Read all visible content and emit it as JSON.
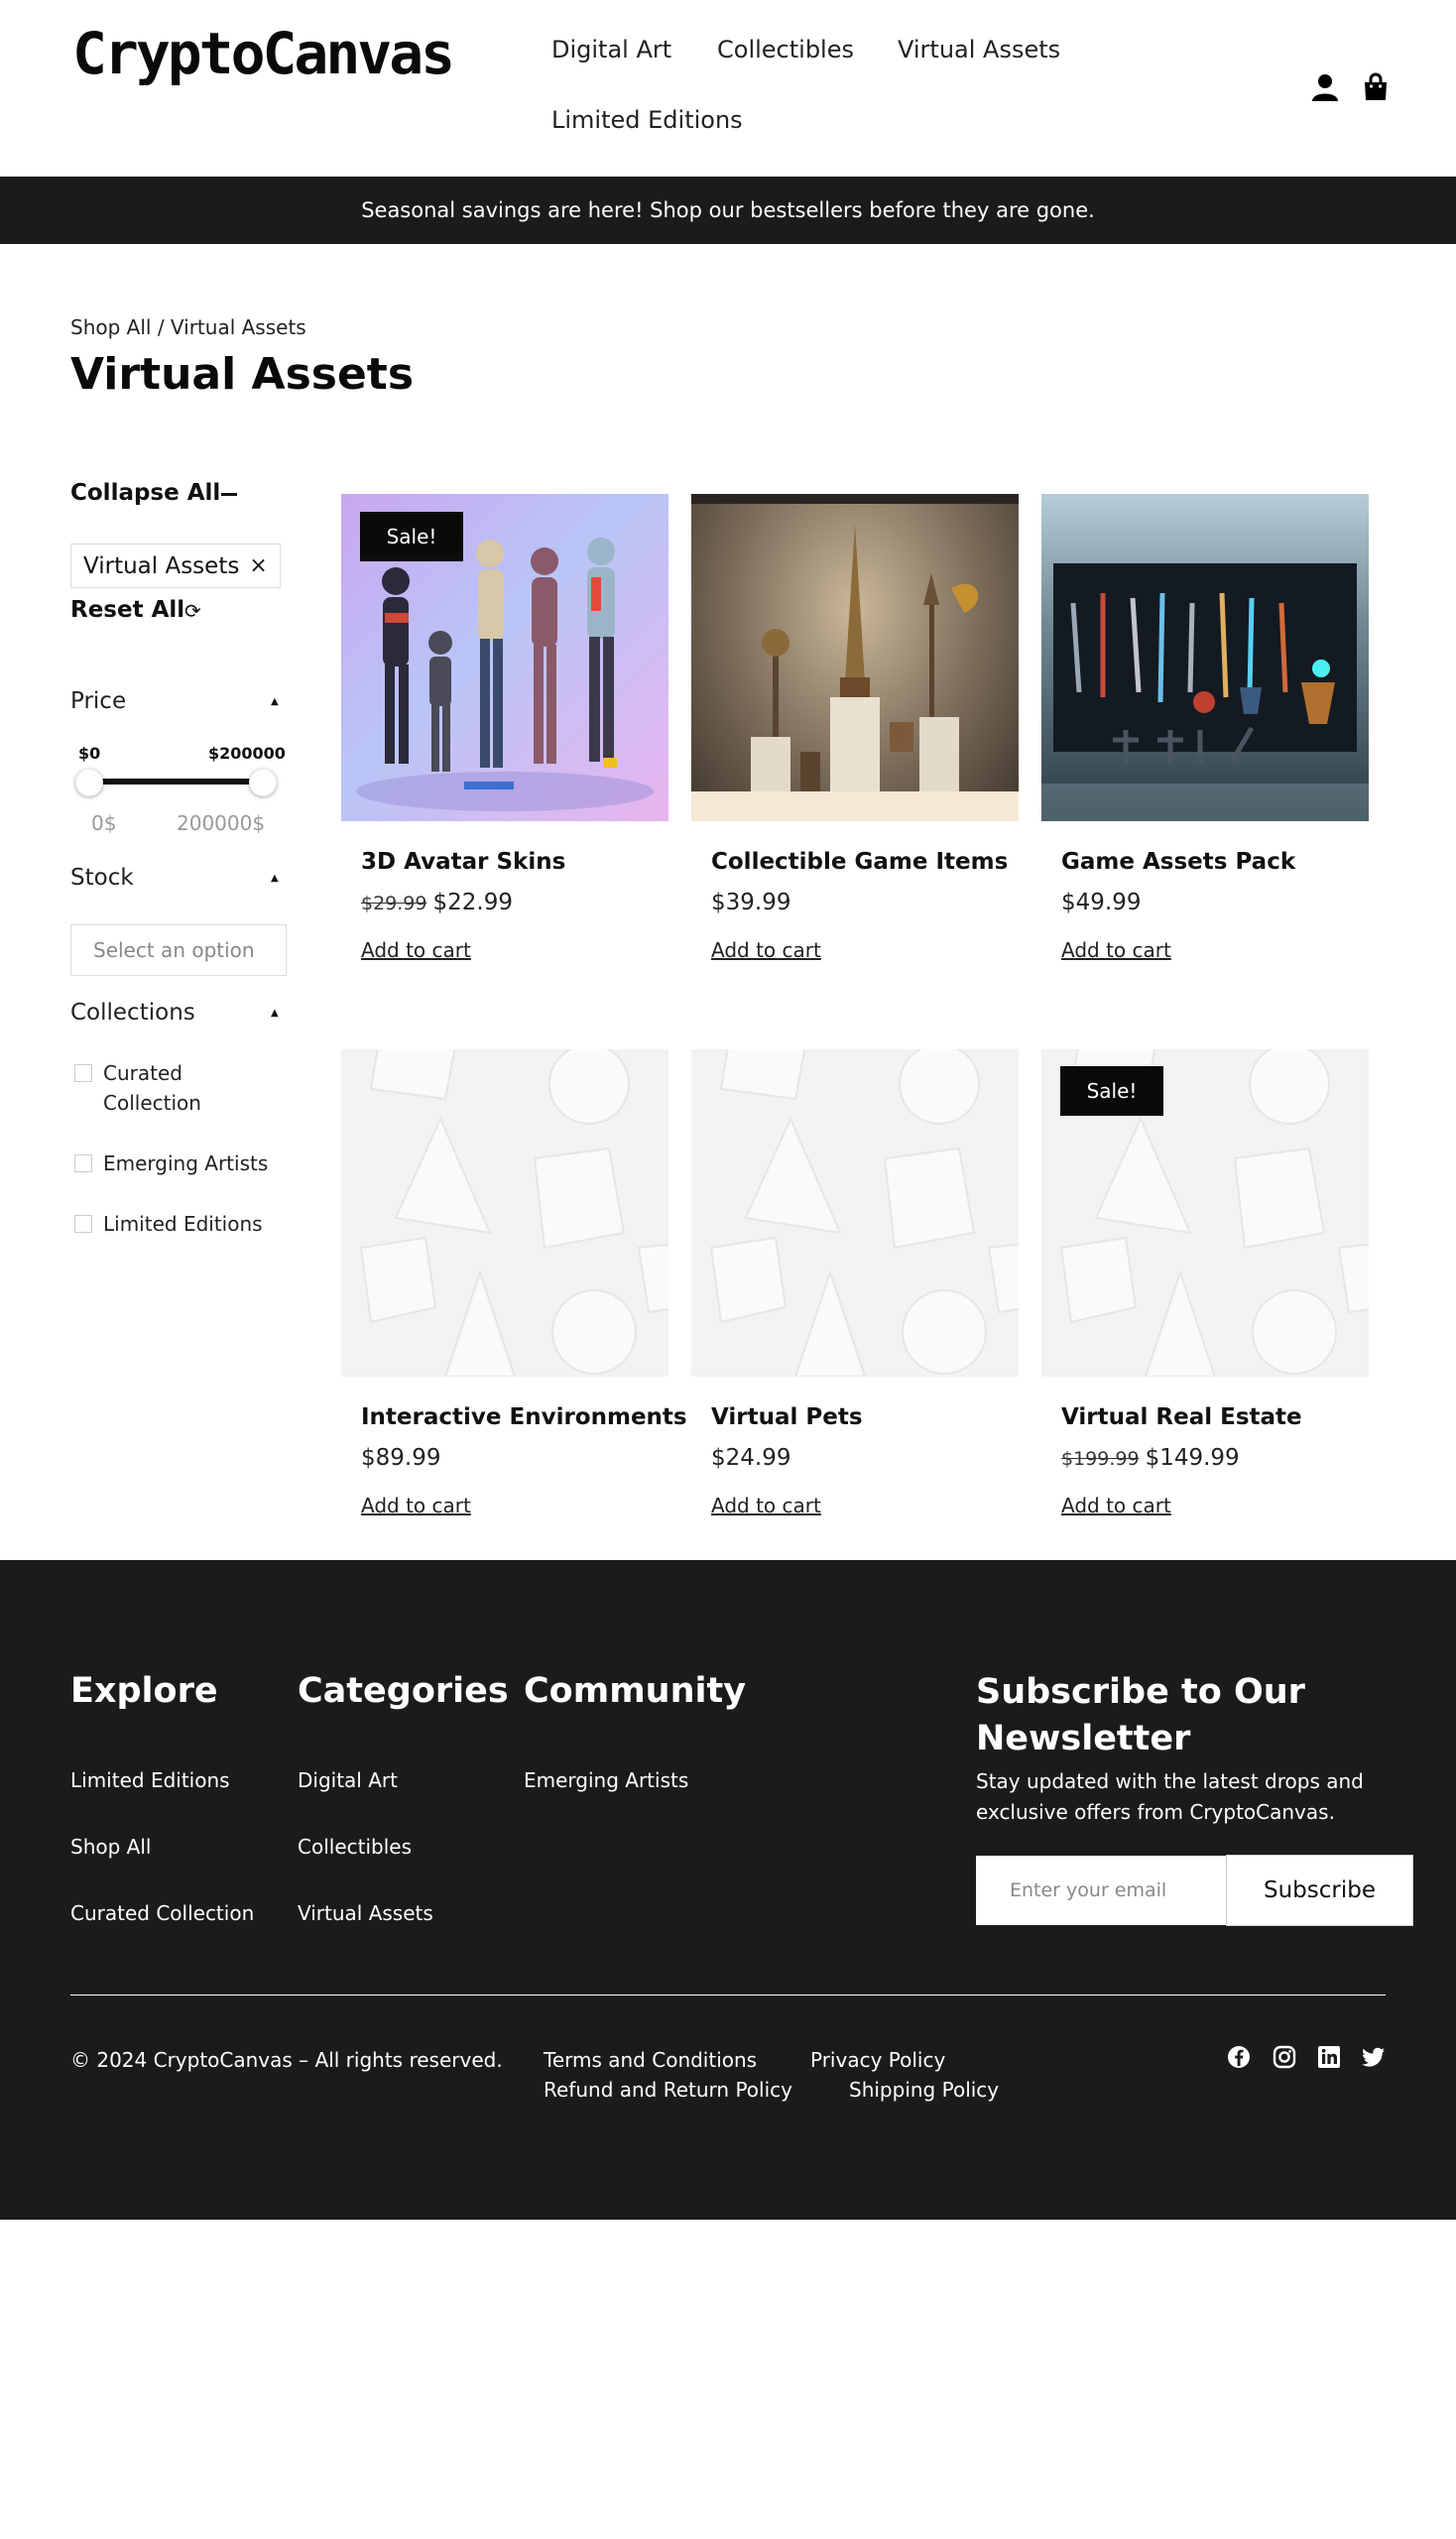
{
  "header": {
    "logo": "CryptoCanvas",
    "nav": [
      "Digital Art",
      "Collectibles",
      "Virtual Assets",
      "Limited Editions"
    ],
    "icons": [
      "user-icon",
      "shopping-bag-icon"
    ]
  },
  "banner": {
    "text": "Seasonal savings are here! Shop our bestsellers before they are gone."
  },
  "breadcrumb": "Shop All / Virtual Assets",
  "page_title": "Virtual Assets",
  "sidebar": {
    "collapse_all": "Collapse All",
    "active_filter": "Virtual Assets",
    "active_filter_remove": "×",
    "reset_all": "Reset All",
    "price": {
      "label": "Price",
      "min_label": "$0",
      "max_label": "$200000",
      "min_value": 0,
      "max_value": 200000,
      "min_field": "0$",
      "max_field": "200000$"
    },
    "stock": {
      "label": "Stock",
      "placeholder": "Select an option"
    },
    "collections": {
      "label": "Collections",
      "options": [
        "Curated Collection",
        "Emerging Artists",
        "Limited Editions"
      ]
    }
  },
  "products": [
    {
      "name": "3D Avatar Skins",
      "old_price": "$29.99",
      "price": "$22.99",
      "sale": "Sale!",
      "cta": "Add to cart"
    },
    {
      "name": "Collectible Game Items",
      "old_price": "",
      "price": "$39.99",
      "sale": "",
      "cta": "Add to cart"
    },
    {
      "name": "Game Assets Pack",
      "old_price": "",
      "price": "$49.99",
      "sale": "",
      "cta": "Add to cart"
    },
    {
      "name": "Interactive Environments",
      "old_price": "",
      "price": "$89.99",
      "sale": "",
      "cta": "Add to cart"
    },
    {
      "name": "Virtual Pets",
      "old_price": "",
      "price": "$24.99",
      "sale": "",
      "cta": "Add to cart"
    },
    {
      "name": "Virtual Real Estate",
      "old_price": "$199.99",
      "price": "$149.99",
      "sale": "Sale!",
      "cta": "Add to cart"
    }
  ],
  "footer": {
    "explore": {
      "title": "Explore",
      "links": [
        "Limited Editions",
        "Shop All",
        "Curated Collection"
      ]
    },
    "categories": {
      "title": "Categories",
      "links": [
        "Digital Art",
        "Collectibles",
        "Virtual Assets"
      ]
    },
    "community": {
      "title": "Community",
      "links": [
        "Emerging Artists"
      ]
    },
    "newsletter": {
      "title": "Subscribe to Our Newsletter",
      "description": "Stay updated with the latest drops and exclusive offers from CryptoCanvas.",
      "placeholder": "Enter your email",
      "button": "Subscribe"
    },
    "copyright": "© 2024 CryptoCanvas – All rights reserved.",
    "legal_links": [
      "Terms and Conditions",
      "Privacy Policy",
      "Refund and Return Policy",
      "Shipping Policy"
    ],
    "social_icons": [
      "facebook-icon",
      "instagram-icon",
      "linkedin-icon",
      "twitter-icon"
    ]
  },
  "colors": {
    "dark": "#1b1b1b",
    "badge": "#0a0a0a",
    "text": "#111111"
  }
}
